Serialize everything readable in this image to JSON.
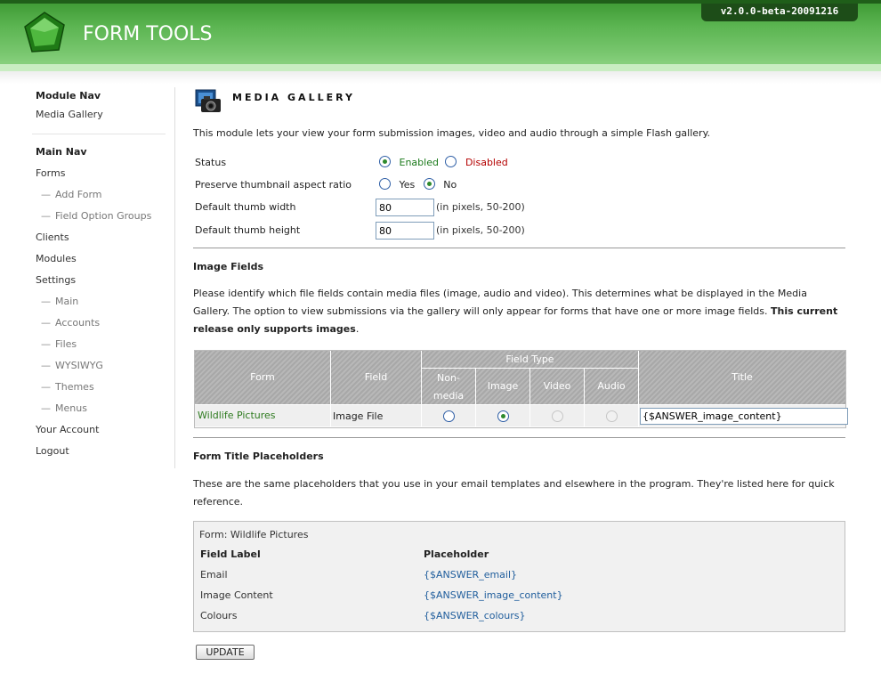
{
  "app": {
    "title": "FORM TOOLS",
    "version": "v2.0.0-beta-20091216"
  },
  "sidebar": {
    "module_nav_heading": "Module Nav",
    "module_items": [
      {
        "label": "Media Gallery"
      }
    ],
    "main_nav_heading": "Main Nav",
    "items": [
      {
        "label": "Forms",
        "sub": false
      },
      {
        "label": "Add Form",
        "sub": true
      },
      {
        "label": "Field Option Groups",
        "sub": true
      },
      {
        "label": "Clients",
        "sub": false
      },
      {
        "label": "Modules",
        "sub": false
      },
      {
        "label": "Settings",
        "sub": false
      },
      {
        "label": "Main",
        "sub": true
      },
      {
        "label": "Accounts",
        "sub": true
      },
      {
        "label": "Files",
        "sub": true
      },
      {
        "label": "WYSIWYG",
        "sub": true
      },
      {
        "label": "Themes",
        "sub": true
      },
      {
        "label": "Menus",
        "sub": true
      },
      {
        "label": "Your Account",
        "sub": false
      },
      {
        "label": "Logout",
        "sub": false
      }
    ],
    "sub_prefix": "—"
  },
  "page": {
    "title": "MEDIA GALLERY",
    "intro": "This module lets your view your form submission images, video and audio through a simple Flash gallery."
  },
  "settings": {
    "status_label": "Status",
    "status_enabled": "Enabled",
    "status_disabled": "Disabled",
    "status_value": "Enabled",
    "preserve_label": "Preserve thumbnail aspect ratio",
    "preserve_yes": "Yes",
    "preserve_no": "No",
    "preserve_value": "No",
    "thumb_width_label": "Default thumb width",
    "thumb_width_value": "80",
    "thumb_height_label": "Default thumb height",
    "thumb_height_value": "80",
    "pixels_hint": "(in pixels, 50-200)"
  },
  "image_fields": {
    "heading": "Image Fields",
    "description": "Please identify which file fields contain media files (image, audio and video). This determines what be displayed in the Media Gallery. The option to view submissions via the gallery will only appear for forms that have one or more image fields.",
    "description_bold": "This current release only supports images",
    "description_end": ".",
    "columns": {
      "form": "Form",
      "field": "Field",
      "field_type": "Field Type",
      "non_media_1": "Non-",
      "non_media_2": "media",
      "image": "Image",
      "video": "Video",
      "audio": "Audio",
      "title": "Title"
    },
    "rows": [
      {
        "form": "Wildlife Pictures",
        "field": "Image File",
        "type": "Image",
        "title": "{$ANSWER_image_content}"
      }
    ]
  },
  "placeholders": {
    "heading": "Form Title Placeholders",
    "description": "These are the same placeholders that you use in your email templates and elsewhere in the program. They're listed here for quick reference.",
    "form_line": "Form: Wildlife Pictures",
    "col_label": "Field Label",
    "col_placeholder": "Placeholder",
    "rows": [
      {
        "label": "Email",
        "placeholder": "{$ANSWER_email}"
      },
      {
        "label": "Image Content",
        "placeholder": "{$ANSWER_image_content}"
      },
      {
        "label": "Colours",
        "placeholder": "{$ANSWER_colours}"
      }
    ]
  },
  "update_label": "UPDATE",
  "colors": {
    "header_green": "#5cb552",
    "accent_green": "#2d7a1e",
    "link_blue": "#1f5d9c",
    "disabled_red": "#b40000"
  }
}
